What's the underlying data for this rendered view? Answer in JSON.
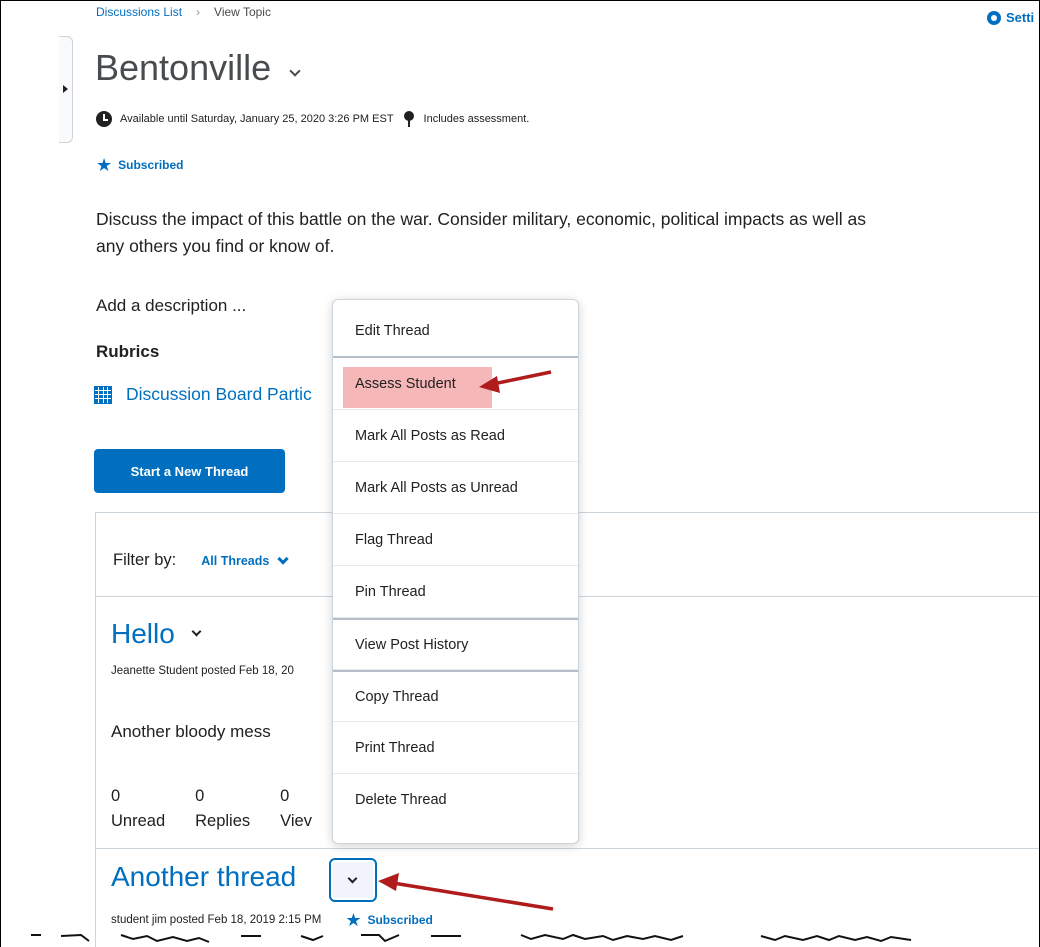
{
  "breadcrumb": {
    "link": "Discussions List",
    "current": "View Topic"
  },
  "settings_label": "Setti",
  "topic": {
    "title": "Bentonville",
    "availability": "Available until Saturday, January 25, 2020 3:26 PM EST",
    "assessment": "Includes assessment.",
    "subscribed": "Subscribed",
    "description": "Discuss the impact of this battle on the war. Consider military, economic, political impacts as well as any others you find or know of.",
    "add_description": "Add a description ...",
    "rubrics_heading": "Rubrics",
    "rubric_link": "Discussion Board Partic"
  },
  "start_thread_label": "Start a New Thread",
  "filter": {
    "label": "Filter by:",
    "value": "All Threads"
  },
  "threads": [
    {
      "title": "Hello",
      "posted": "Jeanette Student posted Feb 18, 20",
      "excerpt": "Another bloody mess",
      "stats": [
        {
          "count": "0",
          "label": "Unread"
        },
        {
          "count": "0",
          "label": "Replies"
        },
        {
          "count": "0",
          "label": "Viev"
        }
      ]
    },
    {
      "title": "Another thread",
      "posted": "student jim posted Feb 18, 2019 2:15 PM",
      "subscribed": "Subscribed"
    }
  ],
  "menu": {
    "items": [
      "Edit Thread",
      "Assess Student",
      "Mark All Posts as Read",
      "Mark All Posts as Unread",
      "Flag Thread",
      "Pin Thread",
      "View Post History",
      "Copy Thread",
      "Print Thread",
      "Delete Thread"
    ],
    "highlight_color": "#f5b7b7"
  },
  "colors": {
    "link": "#006fbf",
    "annotation_arrow": "#b01c1c"
  }
}
